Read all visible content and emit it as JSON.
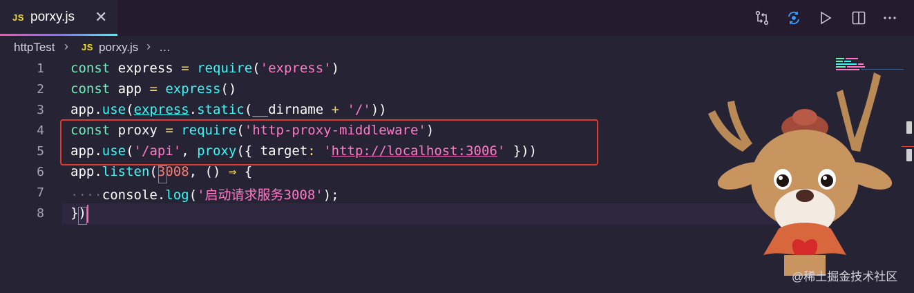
{
  "tab": {
    "badge": "JS",
    "title": "porxy.js",
    "close": "✕"
  },
  "breadcrumb": {
    "folder": "httpTest",
    "sep": "›",
    "badge": "JS",
    "file": "porxy.js",
    "more": "…"
  },
  "line_numbers": [
    "1",
    "2",
    "3",
    "4",
    "5",
    "6",
    "7",
    "8"
  ],
  "code": {
    "l1": {
      "kw": "const",
      "var": "express",
      "op": "=",
      "fn": "require",
      "p1": "(",
      "str": "'express'",
      "p2": ")"
    },
    "l2": {
      "kw": "const",
      "var": "app",
      "op": "=",
      "fn": "express",
      "p": "()"
    },
    "l3": {
      "obj": "app",
      "dot": ".",
      "fn": "use",
      "p1": "(",
      "arg": "express",
      "dot2": ".",
      "fn2": "static",
      "p2": "(",
      "dir": "__dirname",
      "op": "+",
      "str": "'/'",
      "p3": "))"
    },
    "l4": {
      "kw": "const",
      "var": "proxy",
      "op": "=",
      "fn": "require",
      "p1": "(",
      "str": "'http-proxy-middleware'",
      "p2": ")"
    },
    "l5": {
      "obj": "app",
      "dot": ".",
      "fn": "use",
      "p1": "(",
      "str1": "'/api'",
      "comma": ",",
      "fn2": "proxy",
      "p2": "({",
      "key": "target",
      "colon": ":",
      "q1": "'",
      "url": "http://localhost:3006",
      "q2": "'",
      "p3": "}))"
    },
    "l6": {
      "obj": "app",
      "dot": ".",
      "fn": "listen",
      "p1": "(",
      "num": "3008",
      "comma": ",",
      "p2": "()",
      "arrow": "⇒",
      "brace": "{"
    },
    "l7": {
      "ws": "····",
      "obj": "console",
      "dot": ".",
      "fn": "log",
      "p1": "(",
      "str": "'启动请求服务3008'",
      "p2": ");"
    },
    "l8": {
      "brace": "}",
      "paren": ")"
    }
  },
  "watermark": "@稀土掘金技术社区",
  "colors": {
    "background": "#262335",
    "highlight": "#e23b2c",
    "accent": "#ff4fb0"
  }
}
